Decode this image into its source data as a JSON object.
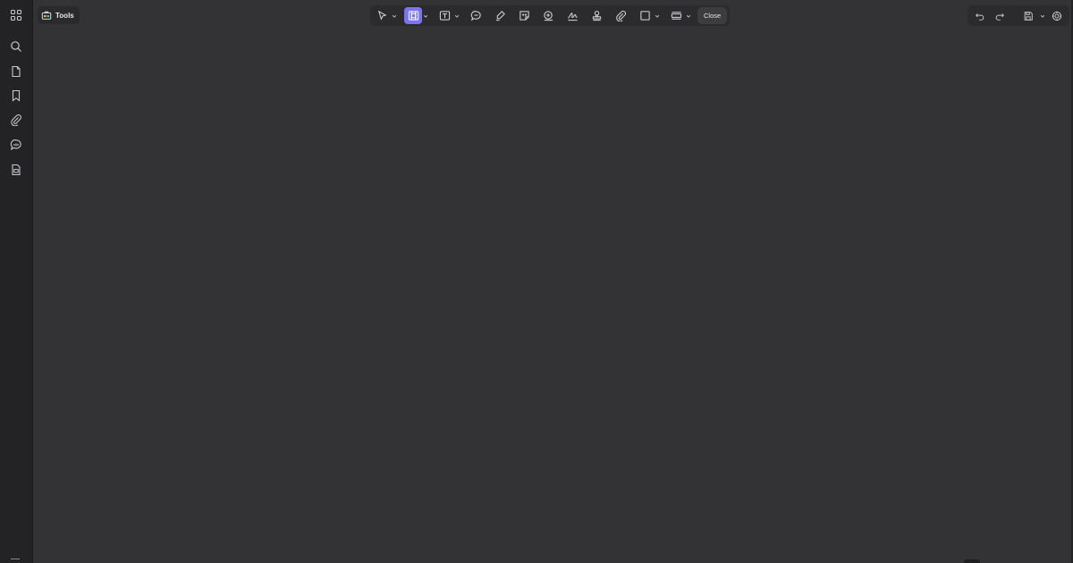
{
  "header": {
    "tools_label": "Tools",
    "close_label": "Close"
  },
  "sidebar": {
    "items": [
      {
        "icon": "apps-grid-icon"
      },
      {
        "icon": "search-icon"
      },
      {
        "icon": "page-icon"
      },
      {
        "icon": "bookmark-icon"
      },
      {
        "icon": "attachment-icon"
      },
      {
        "icon": "comment-icon"
      },
      {
        "icon": "form-fields-icon"
      }
    ]
  },
  "toolbar": {
    "tools": [
      {
        "icon": "select-cursor-icon",
        "has_menu": true
      },
      {
        "icon": "edit-content-icon",
        "has_menu": true,
        "active": true
      },
      {
        "icon": "text-box-icon",
        "has_menu": true
      },
      {
        "icon": "comment-icon"
      },
      {
        "icon": "highlight-icon"
      },
      {
        "icon": "sticky-note-icon"
      },
      {
        "icon": "stamp-zoom-icon"
      },
      {
        "icon": "signature-icon"
      },
      {
        "icon": "stamp-icon"
      },
      {
        "icon": "attachment-icon"
      },
      {
        "icon": "shape-rectangle-icon",
        "has_menu": true
      },
      {
        "icon": "measure-icon",
        "has_menu": true
      }
    ]
  },
  "right_toolbar": {
    "items": [
      "undo-icon",
      "redo-icon",
      "save-icon",
      "ai-assistant-icon"
    ]
  },
  "colors": {
    "canvas": "#333235",
    "chrome": "#232325",
    "accent": "#7b74f0"
  }
}
